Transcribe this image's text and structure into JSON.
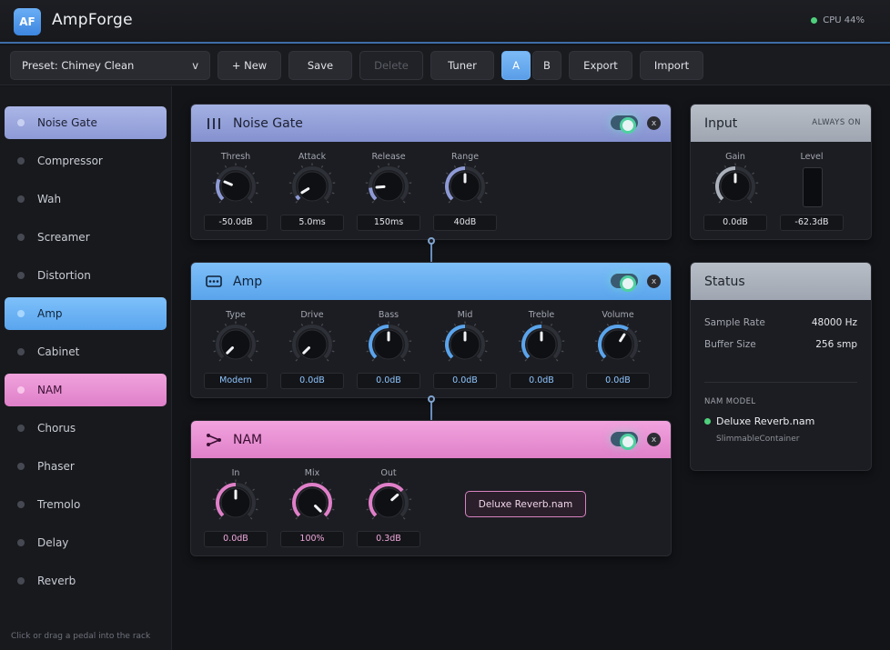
{
  "app": {
    "logo": "AF",
    "title": "AmpForge",
    "cpu": "CPU 44%",
    "cpu_color": "#4fd07c"
  },
  "toolbar": {
    "preset": "Preset: Chimey Clean",
    "preset_caret": "v",
    "new_label": "+ New",
    "save_label": "Save",
    "delete_label": "Delete",
    "tuner_label": "Tuner",
    "slot_a": "A",
    "slot_b": "B",
    "export_label": "Export",
    "import_label": "Import"
  },
  "sidebar": {
    "items": [
      {
        "label": "Noise Gate",
        "active": true
      },
      {
        "label": "Compressor",
        "active": false
      },
      {
        "label": "Wah",
        "active": false
      },
      {
        "label": "Screamer",
        "active": false
      },
      {
        "label": "Distortion",
        "active": false
      },
      {
        "label": "Amp",
        "active": true
      },
      {
        "label": "Cabinet",
        "active": false
      },
      {
        "label": "NAM",
        "active": true
      },
      {
        "label": "Chorus",
        "active": false
      },
      {
        "label": "Phaser",
        "active": false
      },
      {
        "label": "Tremolo",
        "active": false
      },
      {
        "label": "Delay",
        "active": false
      },
      {
        "label": "Reverb",
        "active": false
      }
    ],
    "hint": "Click or drag a pedal into the rack"
  },
  "noise_gate": {
    "title": "Noise Gate",
    "icon": "bars-icon",
    "close": "x",
    "knobs": [
      {
        "label": "Thresh",
        "value": "-50.0dB",
        "level": 0.25
      },
      {
        "label": "Attack",
        "value": "5.0ms",
        "level": 0.05
      },
      {
        "label": "Release",
        "value": "150ms",
        "level": 0.15
      },
      {
        "label": "Range",
        "value": "40dB",
        "level": 0.5
      }
    ]
  },
  "amp": {
    "title": "Amp",
    "icon": "amp-icon",
    "close": "x",
    "knobs": [
      {
        "label": "Type",
        "value": "Modern",
        "level": 0.0
      },
      {
        "label": "Drive",
        "value": "0.0dB",
        "level": 0.0
      },
      {
        "label": "Bass",
        "value": "0.0dB",
        "level": 0.5
      },
      {
        "label": "Mid",
        "value": "0.0dB",
        "level": 0.5
      },
      {
        "label": "Treble",
        "value": "0.0dB",
        "level": 0.5
      },
      {
        "label": "Volume",
        "value": "0.0dB",
        "level": 0.62
      }
    ]
  },
  "nam": {
    "title": "NAM",
    "icon": "share-icon",
    "close": "x",
    "knobs": [
      {
        "label": "In",
        "value": "0.0dB",
        "level": 0.5
      },
      {
        "label": "Mix",
        "value": "100%",
        "level": 1.0
      },
      {
        "label": "Out",
        "value": "0.3dB",
        "level": 0.68
      }
    ],
    "file_button": "Deluxe Reverb.nam"
  },
  "input": {
    "title": "Input",
    "badge": "ALWAYS ON",
    "gain_label": "Gain",
    "gain_value": "0.0dB",
    "gain_level": 0.5,
    "level_label": "Level",
    "level_value": "-62.3dB"
  },
  "status": {
    "title": "Status",
    "sample_rate_label": "Sample Rate",
    "sample_rate_value": "48000 Hz",
    "buffer_label": "Buffer Size",
    "buffer_value": "256 smp",
    "nam_model_label": "NAM MODEL",
    "nam_model_name": "Deluxe Reverb.nam",
    "nam_model_arch": "SlimmableContainer"
  },
  "colors": {
    "gate_accent": "#8e9ad6",
    "amp_accent": "#5aa4ec",
    "nam_accent": "#e07fc9",
    "input_accent": "#aab1bb"
  }
}
